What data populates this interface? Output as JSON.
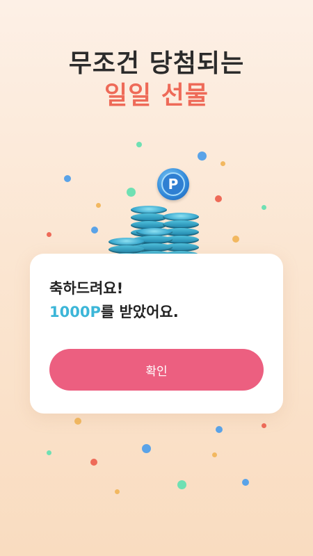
{
  "headline": {
    "line1": "무조건 당첨되는",
    "line2": "일일 선물"
  },
  "coin_icon_letter": "P",
  "dialog": {
    "message_line1": "축하드려요!",
    "points_amount": "1000P",
    "message_line2_rest": "를 받았어요.",
    "confirm_label": "확인"
  },
  "colors": {
    "accent_red": "#ee6a58",
    "button_pink": "#ec5f80",
    "points_blue": "#3cb6d8"
  }
}
